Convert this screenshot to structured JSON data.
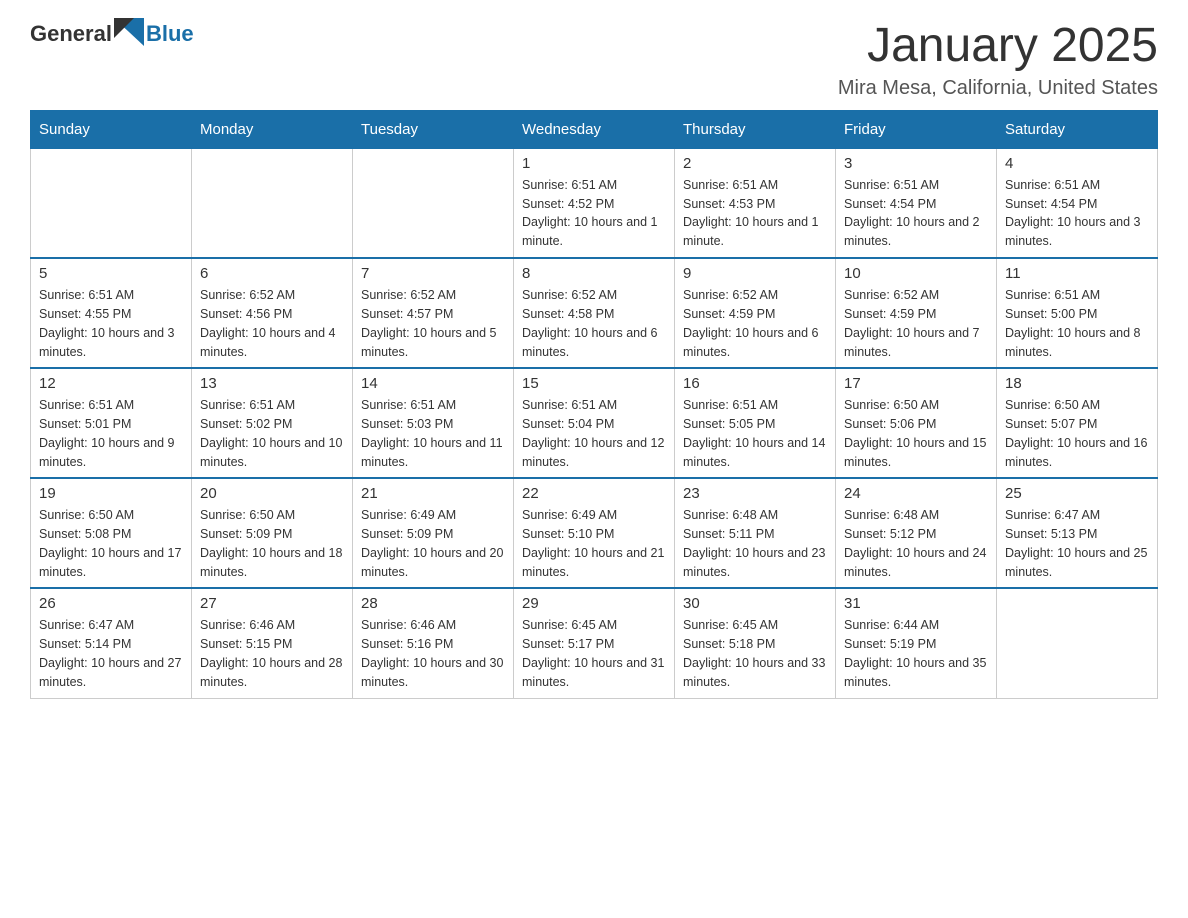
{
  "header": {
    "logo": {
      "text_general": "General",
      "text_blue": "Blue"
    },
    "title": "January 2025",
    "location": "Mira Mesa, California, United States"
  },
  "columns": [
    "Sunday",
    "Monday",
    "Tuesday",
    "Wednesday",
    "Thursday",
    "Friday",
    "Saturday"
  ],
  "weeks": [
    [
      {
        "day": "",
        "info": ""
      },
      {
        "day": "",
        "info": ""
      },
      {
        "day": "",
        "info": ""
      },
      {
        "day": "1",
        "info": "Sunrise: 6:51 AM\nSunset: 4:52 PM\nDaylight: 10 hours and 1 minute."
      },
      {
        "day": "2",
        "info": "Sunrise: 6:51 AM\nSunset: 4:53 PM\nDaylight: 10 hours and 1 minute."
      },
      {
        "day": "3",
        "info": "Sunrise: 6:51 AM\nSunset: 4:54 PM\nDaylight: 10 hours and 2 minutes."
      },
      {
        "day": "4",
        "info": "Sunrise: 6:51 AM\nSunset: 4:54 PM\nDaylight: 10 hours and 3 minutes."
      }
    ],
    [
      {
        "day": "5",
        "info": "Sunrise: 6:51 AM\nSunset: 4:55 PM\nDaylight: 10 hours and 3 minutes."
      },
      {
        "day": "6",
        "info": "Sunrise: 6:52 AM\nSunset: 4:56 PM\nDaylight: 10 hours and 4 minutes."
      },
      {
        "day": "7",
        "info": "Sunrise: 6:52 AM\nSunset: 4:57 PM\nDaylight: 10 hours and 5 minutes."
      },
      {
        "day": "8",
        "info": "Sunrise: 6:52 AM\nSunset: 4:58 PM\nDaylight: 10 hours and 6 minutes."
      },
      {
        "day": "9",
        "info": "Sunrise: 6:52 AM\nSunset: 4:59 PM\nDaylight: 10 hours and 6 minutes."
      },
      {
        "day": "10",
        "info": "Sunrise: 6:52 AM\nSunset: 4:59 PM\nDaylight: 10 hours and 7 minutes."
      },
      {
        "day": "11",
        "info": "Sunrise: 6:51 AM\nSunset: 5:00 PM\nDaylight: 10 hours and 8 minutes."
      }
    ],
    [
      {
        "day": "12",
        "info": "Sunrise: 6:51 AM\nSunset: 5:01 PM\nDaylight: 10 hours and 9 minutes."
      },
      {
        "day": "13",
        "info": "Sunrise: 6:51 AM\nSunset: 5:02 PM\nDaylight: 10 hours and 10 minutes."
      },
      {
        "day": "14",
        "info": "Sunrise: 6:51 AM\nSunset: 5:03 PM\nDaylight: 10 hours and 11 minutes."
      },
      {
        "day": "15",
        "info": "Sunrise: 6:51 AM\nSunset: 5:04 PM\nDaylight: 10 hours and 12 minutes."
      },
      {
        "day": "16",
        "info": "Sunrise: 6:51 AM\nSunset: 5:05 PM\nDaylight: 10 hours and 14 minutes."
      },
      {
        "day": "17",
        "info": "Sunrise: 6:50 AM\nSunset: 5:06 PM\nDaylight: 10 hours and 15 minutes."
      },
      {
        "day": "18",
        "info": "Sunrise: 6:50 AM\nSunset: 5:07 PM\nDaylight: 10 hours and 16 minutes."
      }
    ],
    [
      {
        "day": "19",
        "info": "Sunrise: 6:50 AM\nSunset: 5:08 PM\nDaylight: 10 hours and 17 minutes."
      },
      {
        "day": "20",
        "info": "Sunrise: 6:50 AM\nSunset: 5:09 PM\nDaylight: 10 hours and 18 minutes."
      },
      {
        "day": "21",
        "info": "Sunrise: 6:49 AM\nSunset: 5:09 PM\nDaylight: 10 hours and 20 minutes."
      },
      {
        "day": "22",
        "info": "Sunrise: 6:49 AM\nSunset: 5:10 PM\nDaylight: 10 hours and 21 minutes."
      },
      {
        "day": "23",
        "info": "Sunrise: 6:48 AM\nSunset: 5:11 PM\nDaylight: 10 hours and 23 minutes."
      },
      {
        "day": "24",
        "info": "Sunrise: 6:48 AM\nSunset: 5:12 PM\nDaylight: 10 hours and 24 minutes."
      },
      {
        "day": "25",
        "info": "Sunrise: 6:47 AM\nSunset: 5:13 PM\nDaylight: 10 hours and 25 minutes."
      }
    ],
    [
      {
        "day": "26",
        "info": "Sunrise: 6:47 AM\nSunset: 5:14 PM\nDaylight: 10 hours and 27 minutes."
      },
      {
        "day": "27",
        "info": "Sunrise: 6:46 AM\nSunset: 5:15 PM\nDaylight: 10 hours and 28 minutes."
      },
      {
        "day": "28",
        "info": "Sunrise: 6:46 AM\nSunset: 5:16 PM\nDaylight: 10 hours and 30 minutes."
      },
      {
        "day": "29",
        "info": "Sunrise: 6:45 AM\nSunset: 5:17 PM\nDaylight: 10 hours and 31 minutes."
      },
      {
        "day": "30",
        "info": "Sunrise: 6:45 AM\nSunset: 5:18 PM\nDaylight: 10 hours and 33 minutes."
      },
      {
        "day": "31",
        "info": "Sunrise: 6:44 AM\nSunset: 5:19 PM\nDaylight: 10 hours and 35 minutes."
      },
      {
        "day": "",
        "info": ""
      }
    ]
  ]
}
